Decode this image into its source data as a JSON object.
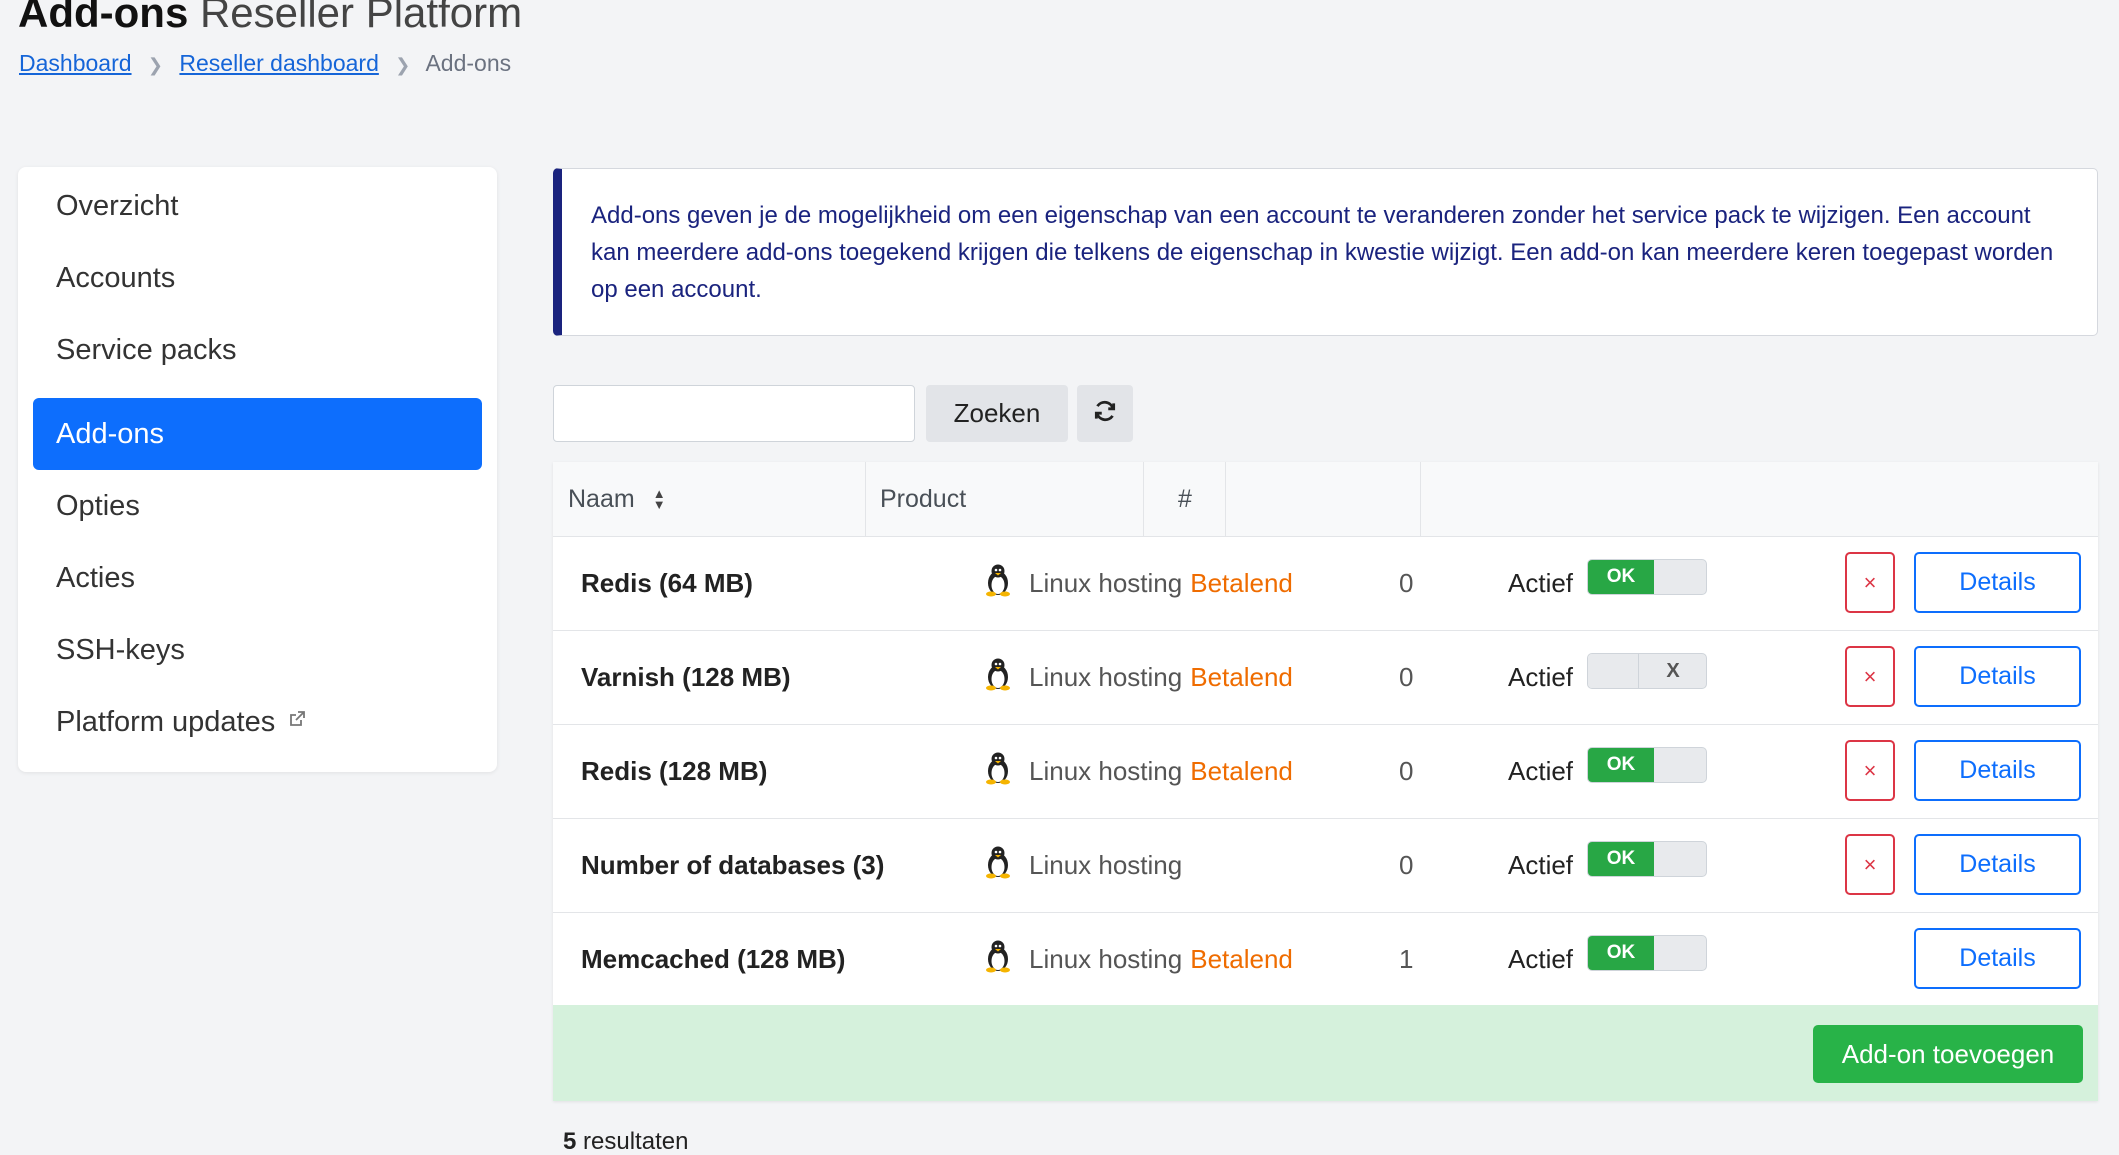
{
  "header": {
    "title_strong": "Add-ons",
    "title_rest": "Reseller Platform"
  },
  "breadcrumb": {
    "items": [
      "Dashboard",
      "Reseller dashboard",
      "Add-ons"
    ]
  },
  "sidebar": {
    "items": [
      {
        "label": "Overzicht"
      },
      {
        "label": "Accounts"
      },
      {
        "label": "Service packs"
      },
      {
        "label": "Add-ons",
        "active": true
      },
      {
        "label": "Opties"
      },
      {
        "label": "Acties"
      },
      {
        "label": "SSH-keys"
      },
      {
        "label": "Platform updates",
        "icon": "external-link-icon"
      }
    ]
  },
  "info": {
    "text": "Add-ons geven je de mogelijkheid om een eigenschap van een account te veranderen zonder het service pack te wijzigen. Een account kan meerdere add-ons toegekend krijgen die telkens de eigenschap in kwestie wijzigt. Een add-on kan meerdere keren toegepast worden op een account."
  },
  "search": {
    "value": "",
    "button_label": "Zoeken",
    "refresh_icon": "refresh-icon"
  },
  "table": {
    "columns": [
      "Naam",
      "Product",
      "#",
      "",
      ""
    ],
    "rows": [
      {
        "name": "Redis (64 MB)",
        "product": "Linux hosting",
        "paid": "Betalend",
        "count": "0",
        "status_label": "Actief",
        "active": true,
        "toggle_on": "OK",
        "toggle_off": "X",
        "deletable": true,
        "details_label": "Details"
      },
      {
        "name": "Varnish (128 MB)",
        "product": "Linux hosting",
        "paid": "Betalend",
        "count": "0",
        "status_label": "Actief",
        "active": false,
        "toggle_on": "OK",
        "toggle_off": "X",
        "deletable": true,
        "details_label": "Details"
      },
      {
        "name": "Redis (128 MB)",
        "product": "Linux hosting",
        "paid": "Betalend",
        "count": "0",
        "status_label": "Actief",
        "active": true,
        "toggle_on": "OK",
        "toggle_off": "X",
        "deletable": true,
        "details_label": "Details"
      },
      {
        "name": "Number of databases (3)",
        "product": "Linux hosting",
        "paid": "",
        "count": "0",
        "status_label": "Actief",
        "active": true,
        "toggle_on": "OK",
        "toggle_off": "X",
        "deletable": true,
        "details_label": "Details"
      },
      {
        "name": "Memcached (128 MB)",
        "product": "Linux hosting",
        "paid": "Betalend",
        "count": "1",
        "status_label": "Actief",
        "active": true,
        "toggle_on": "OK",
        "toggle_off": "X",
        "deletable": false,
        "details_label": "Details"
      }
    ],
    "delete_symbol": "×",
    "add_button_label": "Add-on toevoegen"
  },
  "results": {
    "count": "5",
    "label": "resultaten"
  },
  "colors": {
    "primary": "#0d6efd",
    "success": "#28a745",
    "danger": "#dc3545",
    "info_border": "#1a237e",
    "paid": "#ef6c00",
    "footer_bg": "#d5f1dc"
  }
}
